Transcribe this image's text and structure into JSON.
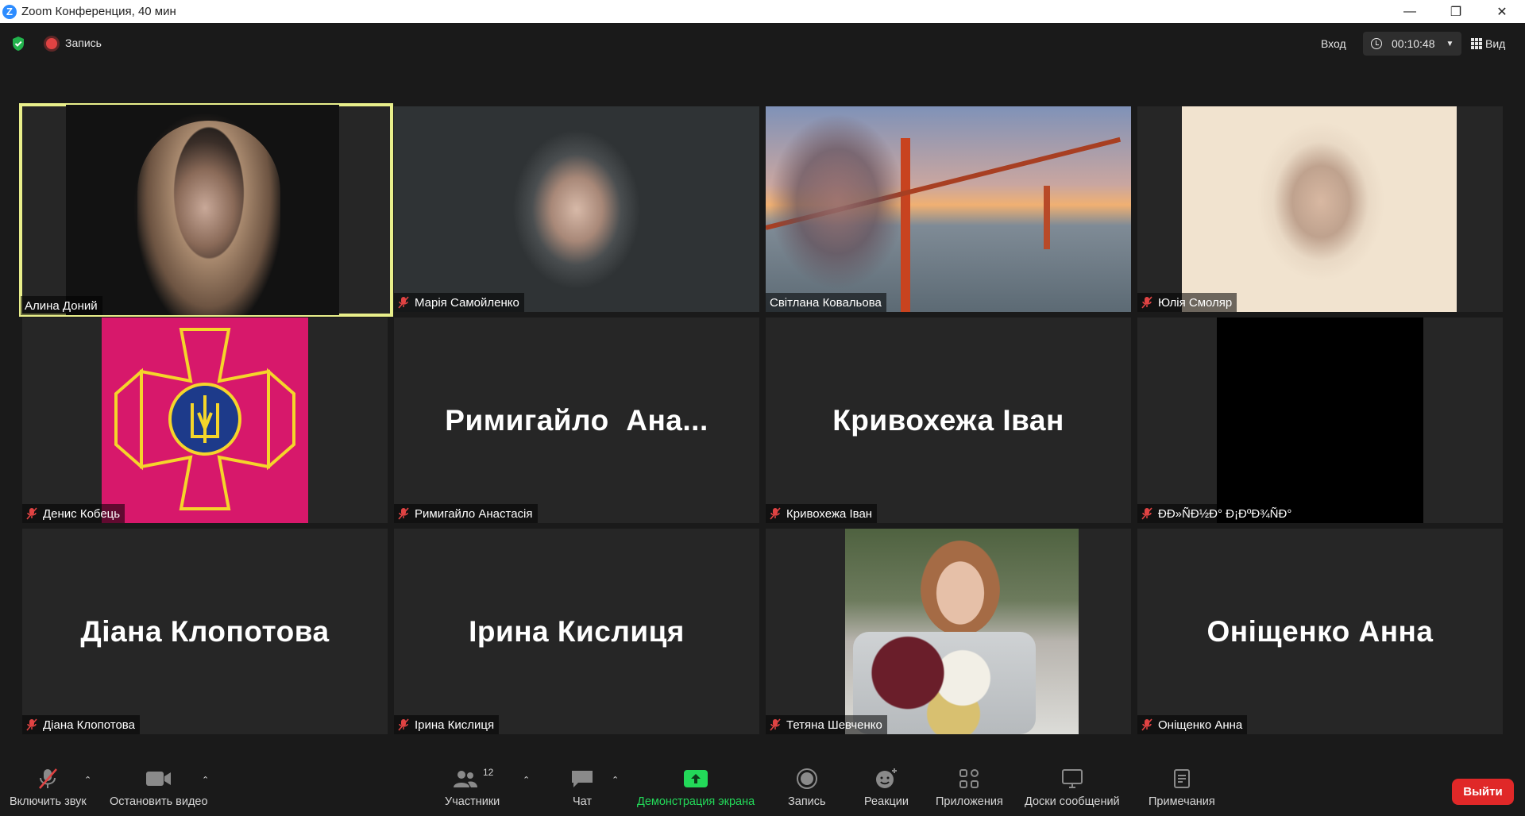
{
  "window": {
    "title": "Zoom Конференция, 40 мин",
    "controls": {
      "minimize": "—",
      "restore": "❐",
      "close": "✕"
    }
  },
  "topbar": {
    "recording_label": "Запись",
    "enter_label": "Вход",
    "timer": "00:10:48",
    "view_label": "Вид"
  },
  "participants": [
    {
      "name": "Алина Доний",
      "muted": false,
      "active": true,
      "display": "video"
    },
    {
      "name": "Марія Самойленко",
      "muted": true,
      "display": "video"
    },
    {
      "name": "Світлана Ковальова",
      "muted": false,
      "display": "video"
    },
    {
      "name": "Юлія Смоляр",
      "muted": true,
      "display": "video"
    },
    {
      "name": "Денис Кобець",
      "muted": true,
      "display": "emblem"
    },
    {
      "name": "Римигайло Анастасія",
      "muted": true,
      "display": "name",
      "big_name": "Римигайло  Ана..."
    },
    {
      "name": "Кривохежа Іван",
      "muted": true,
      "display": "name",
      "big_name": "Кривохежа Іван"
    },
    {
      "name": "ÐÐ»ÑÐ½Ð° Ð¡ÐºÐ¾ÑÐ°",
      "muted": true,
      "display": "black"
    },
    {
      "name": "Діана Клопотова",
      "muted": true,
      "display": "name",
      "big_name": "Діана Клопотова"
    },
    {
      "name": "Ірина Кислиця",
      "muted": true,
      "display": "name",
      "big_name": "Ірина Кислиця"
    },
    {
      "name": "Тетяна Шевченко",
      "muted": true,
      "display": "video"
    },
    {
      "name": "Оніщенко Анна",
      "muted": true,
      "display": "name",
      "big_name": "Оніщенко Анна"
    }
  ],
  "toolbar": {
    "unmute": "Включить звук",
    "stop_video": "Остановить видео",
    "participants": "Участники",
    "participants_count": "12",
    "chat": "Чат",
    "share_screen": "Демонстрация экрана",
    "record": "Запись",
    "reactions": "Реакции",
    "apps": "Приложения",
    "whiteboards": "Доски сообщений",
    "notes": "Примечания",
    "leave": "Выйти"
  },
  "colors": {
    "active_speaker_border": "#e9ef8b",
    "share_green": "#23d959",
    "leave_red": "#e02828",
    "mute_red": "#e04343"
  }
}
